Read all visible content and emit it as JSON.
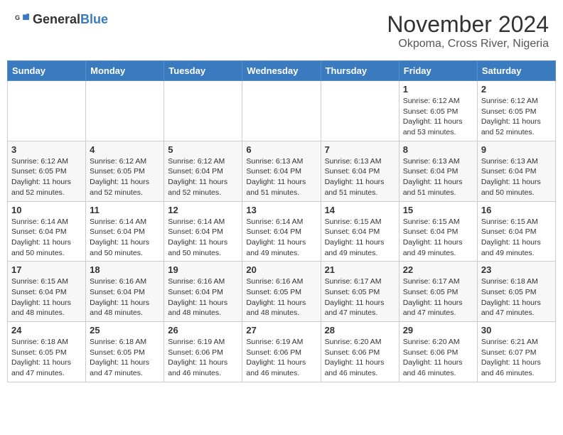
{
  "header": {
    "logo_general": "General",
    "logo_blue": "Blue",
    "month": "November 2024",
    "location": "Okpoma, Cross River, Nigeria"
  },
  "days_of_week": [
    "Sunday",
    "Monday",
    "Tuesday",
    "Wednesday",
    "Thursday",
    "Friday",
    "Saturday"
  ],
  "weeks": [
    [
      {
        "day": "",
        "info": ""
      },
      {
        "day": "",
        "info": ""
      },
      {
        "day": "",
        "info": ""
      },
      {
        "day": "",
        "info": ""
      },
      {
        "day": "",
        "info": ""
      },
      {
        "day": "1",
        "info": "Sunrise: 6:12 AM\nSunset: 6:05 PM\nDaylight: 11 hours\nand 53 minutes."
      },
      {
        "day": "2",
        "info": "Sunrise: 6:12 AM\nSunset: 6:05 PM\nDaylight: 11 hours\nand 52 minutes."
      }
    ],
    [
      {
        "day": "3",
        "info": "Sunrise: 6:12 AM\nSunset: 6:05 PM\nDaylight: 11 hours\nand 52 minutes."
      },
      {
        "day": "4",
        "info": "Sunrise: 6:12 AM\nSunset: 6:05 PM\nDaylight: 11 hours\nand 52 minutes."
      },
      {
        "day": "5",
        "info": "Sunrise: 6:12 AM\nSunset: 6:04 PM\nDaylight: 11 hours\nand 52 minutes."
      },
      {
        "day": "6",
        "info": "Sunrise: 6:13 AM\nSunset: 6:04 PM\nDaylight: 11 hours\nand 51 minutes."
      },
      {
        "day": "7",
        "info": "Sunrise: 6:13 AM\nSunset: 6:04 PM\nDaylight: 11 hours\nand 51 minutes."
      },
      {
        "day": "8",
        "info": "Sunrise: 6:13 AM\nSunset: 6:04 PM\nDaylight: 11 hours\nand 51 minutes."
      },
      {
        "day": "9",
        "info": "Sunrise: 6:13 AM\nSunset: 6:04 PM\nDaylight: 11 hours\nand 50 minutes."
      }
    ],
    [
      {
        "day": "10",
        "info": "Sunrise: 6:14 AM\nSunset: 6:04 PM\nDaylight: 11 hours\nand 50 minutes."
      },
      {
        "day": "11",
        "info": "Sunrise: 6:14 AM\nSunset: 6:04 PM\nDaylight: 11 hours\nand 50 minutes."
      },
      {
        "day": "12",
        "info": "Sunrise: 6:14 AM\nSunset: 6:04 PM\nDaylight: 11 hours\nand 50 minutes."
      },
      {
        "day": "13",
        "info": "Sunrise: 6:14 AM\nSunset: 6:04 PM\nDaylight: 11 hours\nand 49 minutes."
      },
      {
        "day": "14",
        "info": "Sunrise: 6:15 AM\nSunset: 6:04 PM\nDaylight: 11 hours\nand 49 minutes."
      },
      {
        "day": "15",
        "info": "Sunrise: 6:15 AM\nSunset: 6:04 PM\nDaylight: 11 hours\nand 49 minutes."
      },
      {
        "day": "16",
        "info": "Sunrise: 6:15 AM\nSunset: 6:04 PM\nDaylight: 11 hours\nand 49 minutes."
      }
    ],
    [
      {
        "day": "17",
        "info": "Sunrise: 6:15 AM\nSunset: 6:04 PM\nDaylight: 11 hours\nand 48 minutes."
      },
      {
        "day": "18",
        "info": "Sunrise: 6:16 AM\nSunset: 6:04 PM\nDaylight: 11 hours\nand 48 minutes."
      },
      {
        "day": "19",
        "info": "Sunrise: 6:16 AM\nSunset: 6:04 PM\nDaylight: 11 hours\nand 48 minutes."
      },
      {
        "day": "20",
        "info": "Sunrise: 6:16 AM\nSunset: 6:05 PM\nDaylight: 11 hours\nand 48 minutes."
      },
      {
        "day": "21",
        "info": "Sunrise: 6:17 AM\nSunset: 6:05 PM\nDaylight: 11 hours\nand 47 minutes."
      },
      {
        "day": "22",
        "info": "Sunrise: 6:17 AM\nSunset: 6:05 PM\nDaylight: 11 hours\nand 47 minutes."
      },
      {
        "day": "23",
        "info": "Sunrise: 6:18 AM\nSunset: 6:05 PM\nDaylight: 11 hours\nand 47 minutes."
      }
    ],
    [
      {
        "day": "24",
        "info": "Sunrise: 6:18 AM\nSunset: 6:05 PM\nDaylight: 11 hours\nand 47 minutes."
      },
      {
        "day": "25",
        "info": "Sunrise: 6:18 AM\nSunset: 6:05 PM\nDaylight: 11 hours\nand 47 minutes."
      },
      {
        "day": "26",
        "info": "Sunrise: 6:19 AM\nSunset: 6:06 PM\nDaylight: 11 hours\nand 46 minutes."
      },
      {
        "day": "27",
        "info": "Sunrise: 6:19 AM\nSunset: 6:06 PM\nDaylight: 11 hours\nand 46 minutes."
      },
      {
        "day": "28",
        "info": "Sunrise: 6:20 AM\nSunset: 6:06 PM\nDaylight: 11 hours\nand 46 minutes."
      },
      {
        "day": "29",
        "info": "Sunrise: 6:20 AM\nSunset: 6:06 PM\nDaylight: 11 hours\nand 46 minutes."
      },
      {
        "day": "30",
        "info": "Sunrise: 6:21 AM\nSunset: 6:07 PM\nDaylight: 11 hours\nand 46 minutes."
      }
    ]
  ]
}
